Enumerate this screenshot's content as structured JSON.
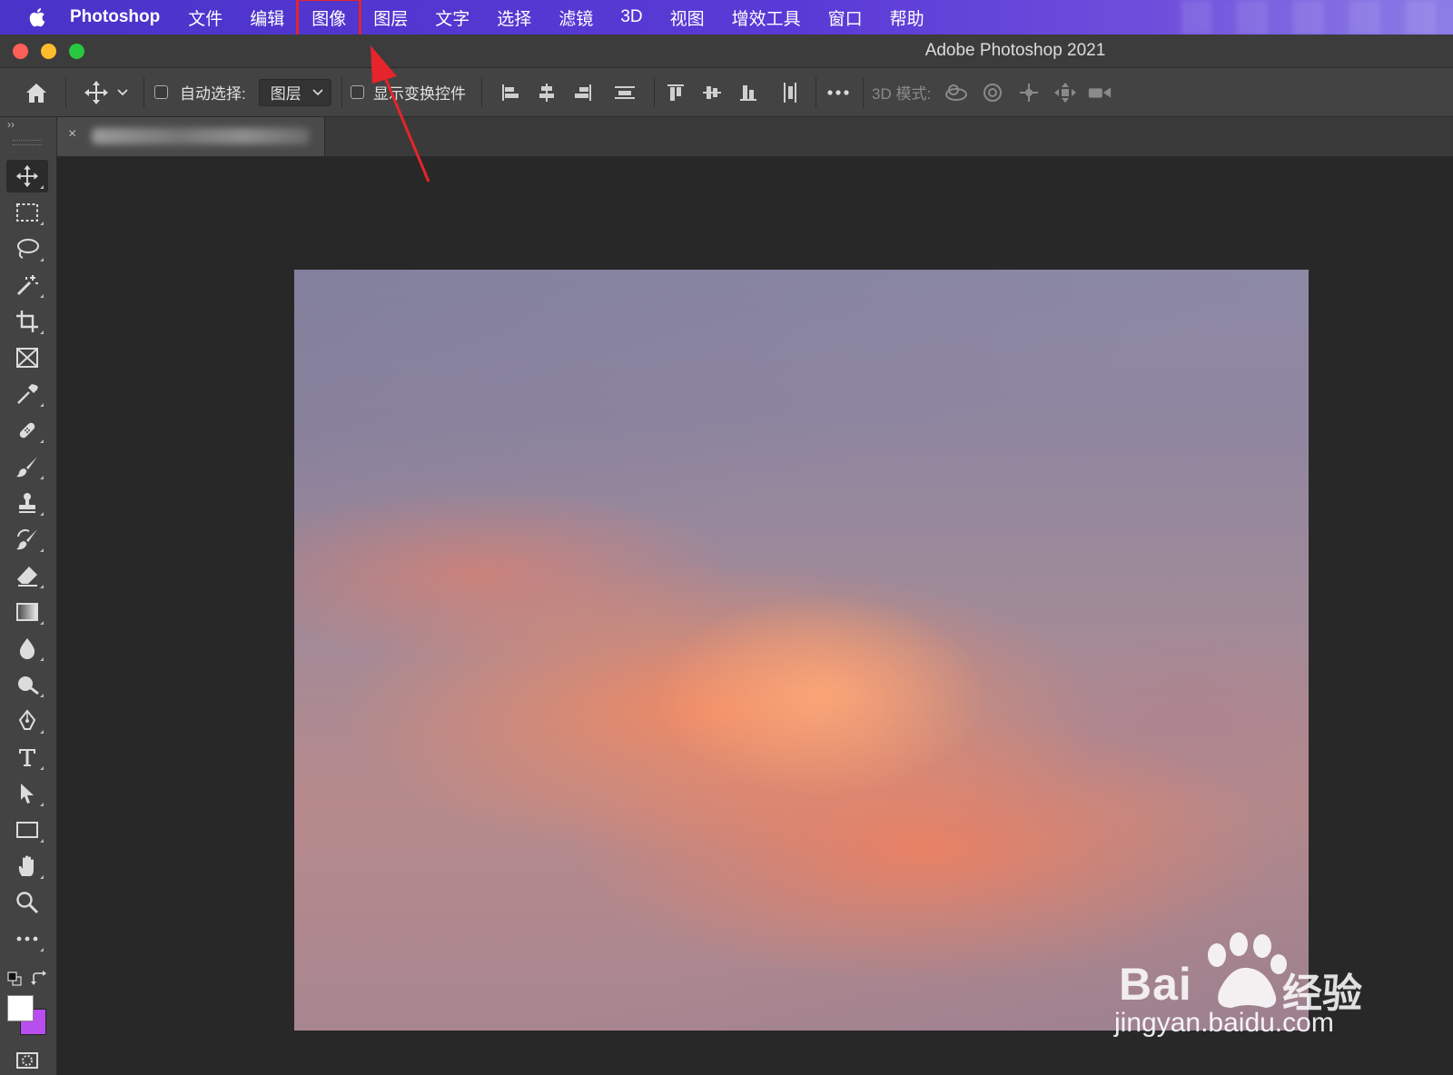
{
  "menubar": {
    "app_name": "Photoshop",
    "items": [
      "文件",
      "编辑",
      "图像",
      "图层",
      "文字",
      "选择",
      "滤镜",
      "3D",
      "视图",
      "增效工具",
      "窗口",
      "帮助"
    ],
    "highlighted_item": "图像"
  },
  "window": {
    "title": "Adobe Photoshop 2021"
  },
  "options_bar": {
    "auto_select_label": "自动选择:",
    "auto_select_target": "图层",
    "show_transform_label": "显示变换控件",
    "mode_3d_label": "3D 模式:"
  },
  "document": {
    "tab_close": "×"
  },
  "tools": [
    "move-tool",
    "rectangular-marquee-tool",
    "lasso-tool",
    "magic-wand-tool",
    "crop-tool",
    "frame-tool",
    "eyedropper-tool",
    "healing-brush-tool",
    "brush-tool",
    "clone-stamp-tool",
    "history-brush-tool",
    "eraser-tool",
    "gradient-tool",
    "blur-tool",
    "dodge-tool",
    "pen-tool",
    "type-tool",
    "path-selection-tool",
    "rectangle-tool",
    "hand-tool",
    "zoom-tool",
    "edit-toolbar"
  ],
  "colors": {
    "foreground": "#ffffff",
    "background": "#b84df0",
    "highlight_box": "#e5242c",
    "arrow": "#e5242c"
  },
  "watermark": {
    "brand": "Bai",
    "brand_cn": "经验",
    "url": "jingyan.baidu.com"
  }
}
